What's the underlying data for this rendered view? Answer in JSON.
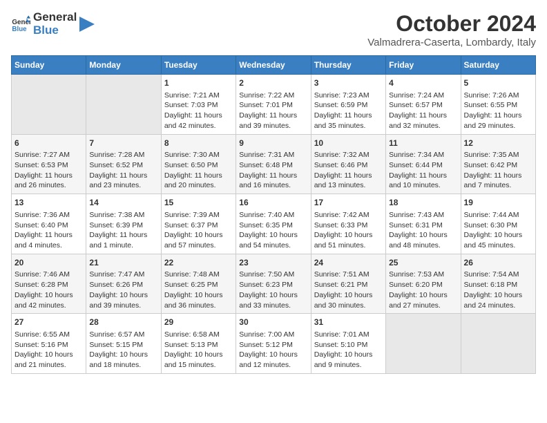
{
  "header": {
    "logo_line1": "General",
    "logo_line2": "Blue",
    "month": "October 2024",
    "location": "Valmadrera-Caserta, Lombardy, Italy"
  },
  "weekdays": [
    "Sunday",
    "Monday",
    "Tuesday",
    "Wednesday",
    "Thursday",
    "Friday",
    "Saturday"
  ],
  "weeks": [
    [
      {
        "day": "",
        "content": ""
      },
      {
        "day": "",
        "content": ""
      },
      {
        "day": "1",
        "content": "Sunrise: 7:21 AM\nSunset: 7:03 PM\nDaylight: 11 hours and 42 minutes."
      },
      {
        "day": "2",
        "content": "Sunrise: 7:22 AM\nSunset: 7:01 PM\nDaylight: 11 hours and 39 minutes."
      },
      {
        "day": "3",
        "content": "Sunrise: 7:23 AM\nSunset: 6:59 PM\nDaylight: 11 hours and 35 minutes."
      },
      {
        "day": "4",
        "content": "Sunrise: 7:24 AM\nSunset: 6:57 PM\nDaylight: 11 hours and 32 minutes."
      },
      {
        "day": "5",
        "content": "Sunrise: 7:26 AM\nSunset: 6:55 PM\nDaylight: 11 hours and 29 minutes."
      }
    ],
    [
      {
        "day": "6",
        "content": "Sunrise: 7:27 AM\nSunset: 6:53 PM\nDaylight: 11 hours and 26 minutes."
      },
      {
        "day": "7",
        "content": "Sunrise: 7:28 AM\nSunset: 6:52 PM\nDaylight: 11 hours and 23 minutes."
      },
      {
        "day": "8",
        "content": "Sunrise: 7:30 AM\nSunset: 6:50 PM\nDaylight: 11 hours and 20 minutes."
      },
      {
        "day": "9",
        "content": "Sunrise: 7:31 AM\nSunset: 6:48 PM\nDaylight: 11 hours and 16 minutes."
      },
      {
        "day": "10",
        "content": "Sunrise: 7:32 AM\nSunset: 6:46 PM\nDaylight: 11 hours and 13 minutes."
      },
      {
        "day": "11",
        "content": "Sunrise: 7:34 AM\nSunset: 6:44 PM\nDaylight: 11 hours and 10 minutes."
      },
      {
        "day": "12",
        "content": "Sunrise: 7:35 AM\nSunset: 6:42 PM\nDaylight: 11 hours and 7 minutes."
      }
    ],
    [
      {
        "day": "13",
        "content": "Sunrise: 7:36 AM\nSunset: 6:40 PM\nDaylight: 11 hours and 4 minutes."
      },
      {
        "day": "14",
        "content": "Sunrise: 7:38 AM\nSunset: 6:39 PM\nDaylight: 11 hours and 1 minute."
      },
      {
        "day": "15",
        "content": "Sunrise: 7:39 AM\nSunset: 6:37 PM\nDaylight: 10 hours and 57 minutes."
      },
      {
        "day": "16",
        "content": "Sunrise: 7:40 AM\nSunset: 6:35 PM\nDaylight: 10 hours and 54 minutes."
      },
      {
        "day": "17",
        "content": "Sunrise: 7:42 AM\nSunset: 6:33 PM\nDaylight: 10 hours and 51 minutes."
      },
      {
        "day": "18",
        "content": "Sunrise: 7:43 AM\nSunset: 6:31 PM\nDaylight: 10 hours and 48 minutes."
      },
      {
        "day": "19",
        "content": "Sunrise: 7:44 AM\nSunset: 6:30 PM\nDaylight: 10 hours and 45 minutes."
      }
    ],
    [
      {
        "day": "20",
        "content": "Sunrise: 7:46 AM\nSunset: 6:28 PM\nDaylight: 10 hours and 42 minutes."
      },
      {
        "day": "21",
        "content": "Sunrise: 7:47 AM\nSunset: 6:26 PM\nDaylight: 10 hours and 39 minutes."
      },
      {
        "day": "22",
        "content": "Sunrise: 7:48 AM\nSunset: 6:25 PM\nDaylight: 10 hours and 36 minutes."
      },
      {
        "day": "23",
        "content": "Sunrise: 7:50 AM\nSunset: 6:23 PM\nDaylight: 10 hours and 33 minutes."
      },
      {
        "day": "24",
        "content": "Sunrise: 7:51 AM\nSunset: 6:21 PM\nDaylight: 10 hours and 30 minutes."
      },
      {
        "day": "25",
        "content": "Sunrise: 7:53 AM\nSunset: 6:20 PM\nDaylight: 10 hours and 27 minutes."
      },
      {
        "day": "26",
        "content": "Sunrise: 7:54 AM\nSunset: 6:18 PM\nDaylight: 10 hours and 24 minutes."
      }
    ],
    [
      {
        "day": "27",
        "content": "Sunrise: 6:55 AM\nSunset: 5:16 PM\nDaylight: 10 hours and 21 minutes."
      },
      {
        "day": "28",
        "content": "Sunrise: 6:57 AM\nSunset: 5:15 PM\nDaylight: 10 hours and 18 minutes."
      },
      {
        "day": "29",
        "content": "Sunrise: 6:58 AM\nSunset: 5:13 PM\nDaylight: 10 hours and 15 minutes."
      },
      {
        "day": "30",
        "content": "Sunrise: 7:00 AM\nSunset: 5:12 PM\nDaylight: 10 hours and 12 minutes."
      },
      {
        "day": "31",
        "content": "Sunrise: 7:01 AM\nSunset: 5:10 PM\nDaylight: 10 hours and 9 minutes."
      },
      {
        "day": "",
        "content": ""
      },
      {
        "day": "",
        "content": ""
      }
    ]
  ]
}
